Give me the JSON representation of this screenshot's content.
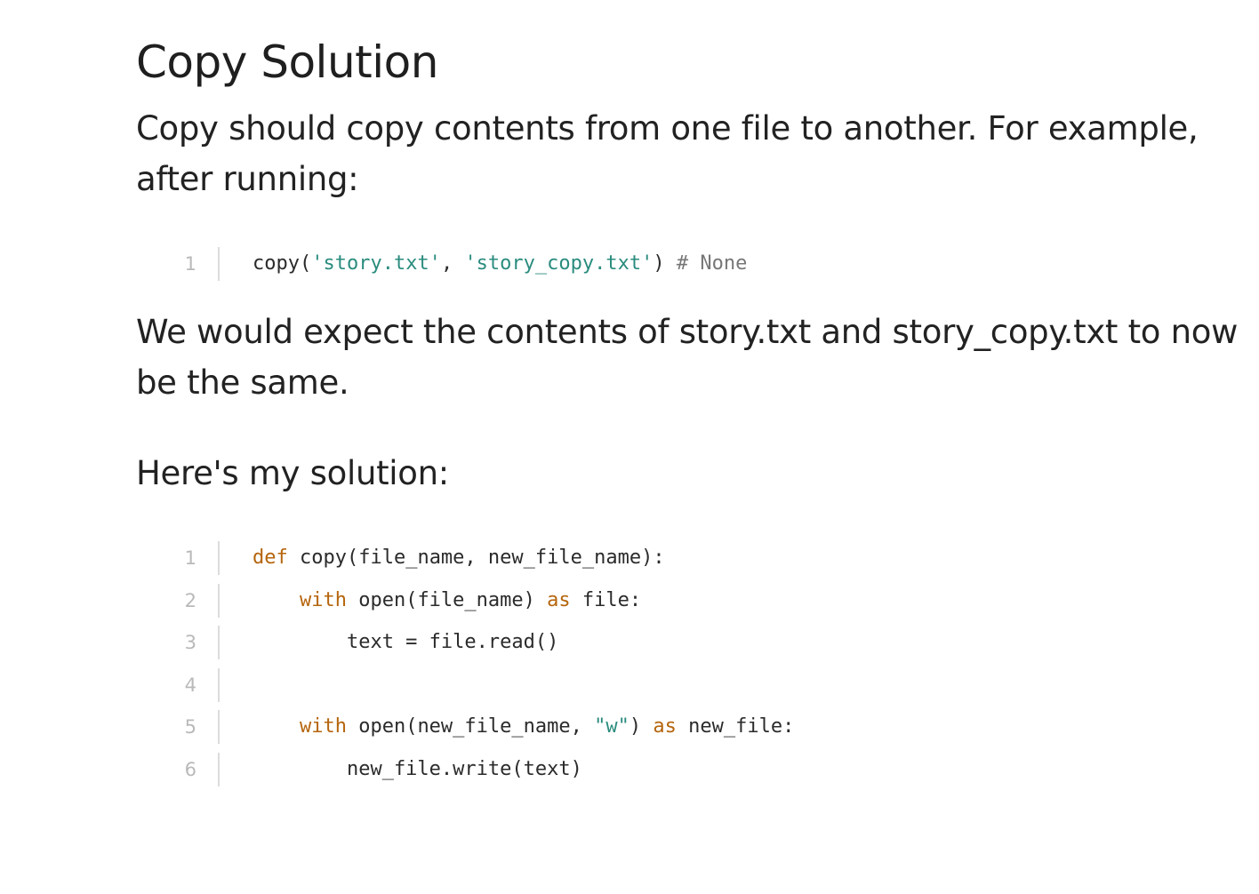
{
  "title": "Copy Solution",
  "intro": {
    "line1": "Copy should copy contents from one file to another.  For example,",
    "line2": "after running:"
  },
  "example_code": {
    "lines": [
      {
        "number": "1",
        "tokens": [
          {
            "text": "copy(",
            "type": "plain"
          },
          {
            "text": "'story.txt'",
            "type": "str"
          },
          {
            "text": ", ",
            "type": "plain"
          },
          {
            "text": "'story_copy.txt'",
            "type": "str"
          },
          {
            "text": ") ",
            "type": "plain"
          },
          {
            "text": "# None",
            "type": "com"
          }
        ]
      }
    ]
  },
  "expectation": {
    "line1": "We would expect the contents of story.txt and story_copy.txt to now",
    "line2": "be the same."
  },
  "solution_intro": "Here's my solution:",
  "solution_code": {
    "lines": [
      {
        "number": "1",
        "tokens": [
          {
            "text": "def",
            "type": "kw"
          },
          {
            "text": " copy(file_name, new_file_name):",
            "type": "plain"
          }
        ]
      },
      {
        "number": "2",
        "tokens": [
          {
            "text": "    ",
            "type": "plain"
          },
          {
            "text": "with",
            "type": "kw"
          },
          {
            "text": " open(file_name) ",
            "type": "plain"
          },
          {
            "text": "as",
            "type": "kw"
          },
          {
            "text": " file:",
            "type": "plain"
          }
        ]
      },
      {
        "number": "3",
        "tokens": [
          {
            "text": "        text = file.read()",
            "type": "plain"
          }
        ]
      },
      {
        "number": "4",
        "tokens": []
      },
      {
        "number": "5",
        "tokens": [
          {
            "text": "    ",
            "type": "plain"
          },
          {
            "text": "with",
            "type": "kw"
          },
          {
            "text": " open(new_file_name, ",
            "type": "plain"
          },
          {
            "text": "\"w\"",
            "type": "str"
          },
          {
            "text": ") ",
            "type": "plain"
          },
          {
            "text": "as",
            "type": "kw"
          },
          {
            "text": " new_file:",
            "type": "plain"
          }
        ]
      },
      {
        "number": "6",
        "tokens": [
          {
            "text": "        new_file.write(text)",
            "type": "plain"
          }
        ]
      }
    ]
  },
  "colors": {
    "keyword": "#b5650d",
    "string": "#2a8c7e",
    "comment": "#777777",
    "line_number": "#b9b9b9"
  }
}
